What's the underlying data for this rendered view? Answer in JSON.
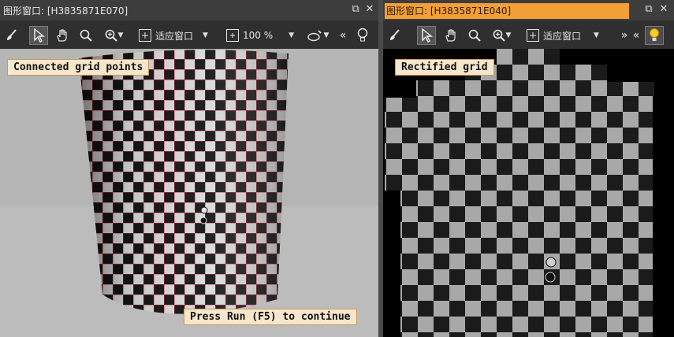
{
  "windows": [
    {
      "title": "图形窗口: [H3835871E070]",
      "zoom_mode": "适应窗口",
      "zoom_value": "100 %",
      "label": "Connected grid points",
      "hint": "Press Run (F5) to continue"
    },
    {
      "title": "图形窗口: [H3835871E040]",
      "zoom_mode": "适应窗口",
      "label": "Rectified grid"
    }
  ],
  "colors": {
    "title_active": "#f39f37",
    "grid_line": "#d0283c",
    "label_bg": "#f6e6cc"
  }
}
